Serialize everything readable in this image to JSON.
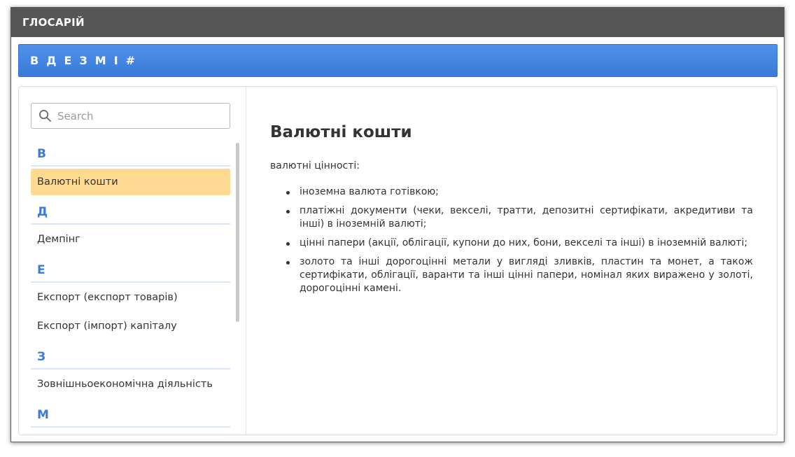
{
  "app": {
    "title": "ГЛОСАРІЙ"
  },
  "alphabet": [
    "В",
    "Д",
    "Е",
    "З",
    "М",
    "І",
    "#"
  ],
  "search": {
    "placeholder": "Search",
    "value": ""
  },
  "groups": [
    {
      "letter": "В",
      "terms": [
        {
          "label": "Валютні кошти",
          "active": true
        }
      ]
    },
    {
      "letter": "Д",
      "terms": [
        {
          "label": "Демпінг",
          "active": false
        }
      ]
    },
    {
      "letter": "Е",
      "terms": [
        {
          "label": "Експорт (експорт товарів)",
          "active": false
        },
        {
          "label": "Експорт (імпорт) капіталу",
          "active": false
        }
      ]
    },
    {
      "letter": "З",
      "terms": [
        {
          "label": "Зовнішньоекономічна діяльність",
          "active": false
        }
      ]
    },
    {
      "letter": "М",
      "terms": []
    }
  ],
  "article": {
    "title": "Валютні кошти",
    "intro": "валютні цінності:",
    "items": [
      "іноземна валюта готівкою;",
      "платіжні документи (чеки, векселі, тратти, депозитні сертифікати, акредитиви та інші) в іноземній валюті;",
      "цінні папери (акції, облігації, купони до них, бони, векселі та інші) в іноземній валюті;",
      "золото та інші дорогоцінні метали у вигляді зливків, пластин та монет, а також сертифікати, облігації, варанти та інші цінні папери, номінал яких виражено у золоті, дорогоцінні камені."
    ]
  },
  "colors": {
    "accent": "#3d7bd8",
    "highlight": "#fdd992",
    "titlebar": "#565656"
  }
}
